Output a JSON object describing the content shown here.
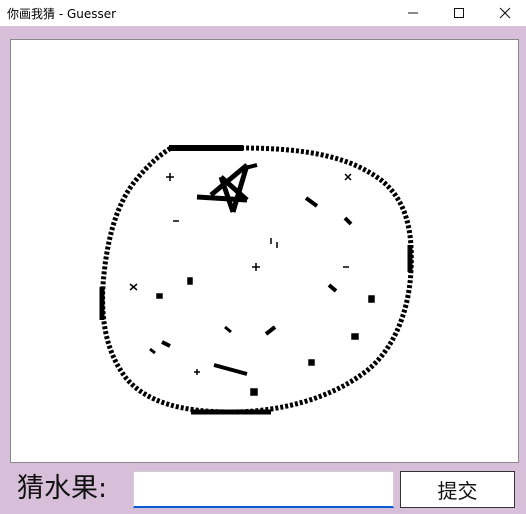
{
  "window": {
    "title": "你画我猜 - Guesser",
    "minimize_icon": "minimize-icon",
    "maximize_icon": "maximize-icon",
    "close_icon": "close-icon"
  },
  "canvas": {
    "drawing": "hand-drawn fruit sketch"
  },
  "footer": {
    "prompt_label": "猜水果:",
    "guess_value": "",
    "guess_placeholder": "",
    "submit_label": "提交"
  },
  "colors": {
    "background": "#d7bfd9",
    "canvas": "#ffffff",
    "ink": "#000000",
    "input_underline": "#0a5bd6"
  }
}
